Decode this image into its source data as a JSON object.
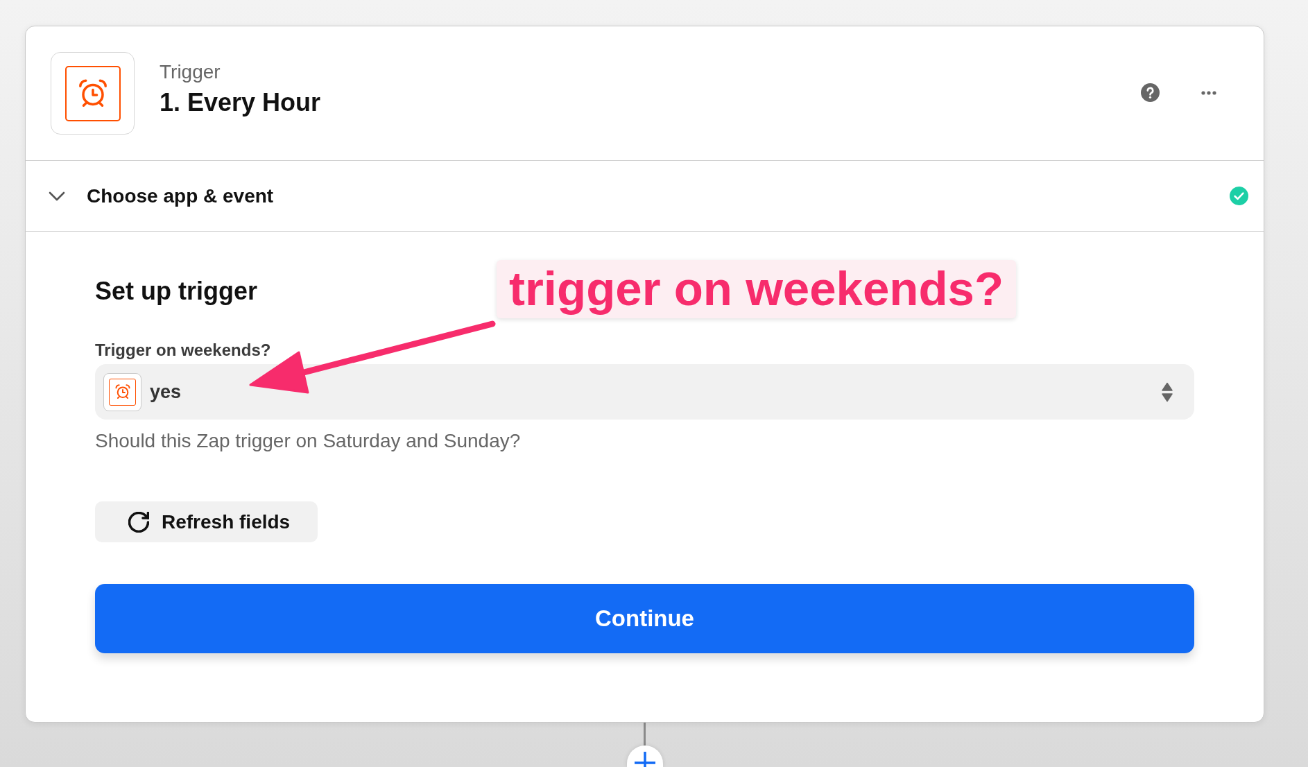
{
  "step": {
    "category": "Trigger",
    "title": "1. Every Hour"
  },
  "section": {
    "title": "Choose app & event",
    "expanded": true,
    "complete": true
  },
  "setup": {
    "title": "Set up trigger",
    "fields": [
      {
        "label": "Trigger on weekends?",
        "value": "yes",
        "help": "Should this Zap trigger on Saturday and Sunday?"
      }
    ]
  },
  "refresh_button": {
    "label": "Refresh fields"
  },
  "continue_button": {
    "label": "Continue"
  },
  "annotation": {
    "text": "trigger on weekends?"
  }
}
